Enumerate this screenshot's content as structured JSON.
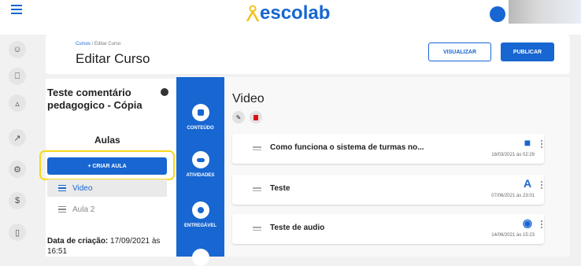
{
  "app": {
    "logo_text": "escolab"
  },
  "header": {
    "breadcrumb_link": "Cursos",
    "breadcrumb_sep": " / ",
    "breadcrumb_current": "Editar Curso",
    "title": "Editar Curso",
    "preview_label": "VISUALIZAR",
    "publish_label": "PUBLICAR"
  },
  "course": {
    "title": "Teste comentário pedagogico - Cópia",
    "lessons_heading": "Aulas",
    "create_lesson_label": "+ CRIAR AULA",
    "lessons": [
      {
        "label": "Video",
        "active": true
      },
      {
        "label": "Aula 2",
        "active": false
      }
    ],
    "created_label": "Data de criação:",
    "created_value": "17/09/2021 às 16:51"
  },
  "tools": [
    {
      "label": "CONTEÚDO",
      "icon": "content-icon"
    },
    {
      "label": "ATIVIDADES",
      "icon": "activities-icon"
    },
    {
      "label": "ENTREGÁVEL",
      "icon": "deliverable-icon"
    }
  ],
  "lesson_content": {
    "title": "Video",
    "items": [
      {
        "title": "Como funciona o sistema de turmas no...",
        "date": "18/03/2021 às 02:29",
        "icon": "video-camera-icon"
      },
      {
        "title": "Teste",
        "date": "07/06/2021 às 23:01",
        "icon": "text-icon"
      },
      {
        "title": "Teste de audio",
        "date": "14/06/2021 às 15:23",
        "icon": "podcast-icon"
      }
    ]
  },
  "colors": {
    "primary": "#1766d1",
    "highlight": "#f6d81b"
  }
}
